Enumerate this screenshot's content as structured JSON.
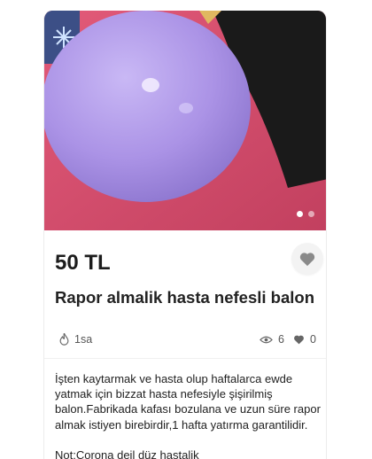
{
  "listing": {
    "price": "50 TL",
    "title": "Rapor almalik hasta nefesli balon",
    "posted_ago": "1sa",
    "views": "6",
    "likes": "0",
    "description": "İşten kaytarmak ve hasta olup haftalarca ewde yatmak için bizzat hasta nefesiyle şişirilmiş balon.Fabrikada kafası bozulana ve uzun süre rapor almak istiyen birebirdir,1 hafta yatırma garantilidir.",
    "note": "Not:Corona deil düz hastalik"
  },
  "gallery": {
    "image_count": 2,
    "active_index": 1
  },
  "icons": {
    "favorite": "heart-icon",
    "time": "flame-icon",
    "views": "eye-icon",
    "likes": "heart-icon"
  },
  "colors": {
    "balloon": "#b49ae8",
    "background_pink": "#d8506d",
    "fav_button_bg": "#f3f3f3",
    "fav_heart": "#8a8a8a"
  }
}
